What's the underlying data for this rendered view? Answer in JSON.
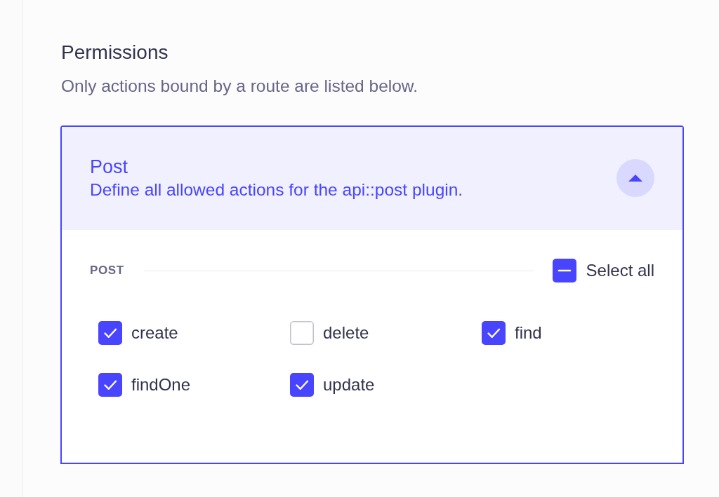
{
  "section": {
    "title": "Permissions",
    "subtitle": "Only actions bound by a route are listed below."
  },
  "accordion": {
    "title": "Post",
    "description": "Define all allowed actions for the api::post plugin.",
    "expanded": true,
    "group": {
      "label": "POST",
      "select_all": {
        "label": "Select all",
        "indeterminate": true
      },
      "actions": [
        {
          "label": "create",
          "checked": true
        },
        {
          "label": "delete",
          "checked": false
        },
        {
          "label": "find",
          "checked": true
        },
        {
          "label": "findOne",
          "checked": true
        },
        {
          "label": "update",
          "checked": true
        }
      ]
    }
  }
}
